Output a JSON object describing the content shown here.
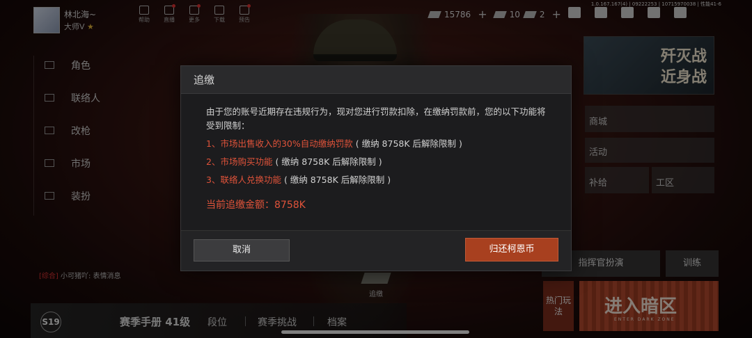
{
  "player": {
    "name": "林北海~",
    "rank": "大师V"
  },
  "top_icons": [
    {
      "label": "帮助"
    },
    {
      "label": "直播"
    },
    {
      "label": "更多"
    },
    {
      "label": "下载"
    },
    {
      "label": "预告"
    }
  ],
  "currencies": {
    "coins": "15786",
    "tickets": "10",
    "tokens": "2"
  },
  "version": "1.0.167.167(4) | 09222253 | 10715970038 | 性能41-6",
  "left_menu": [
    "角色",
    "联络人",
    "改枪",
    "市场",
    "装扮"
  ],
  "chat": {
    "channel": "[综合]",
    "text": "小可猪吖: 表情消息"
  },
  "bottom": {
    "season": "S19",
    "season_book": "赛季手册 41级",
    "tabs": [
      "段位",
      "赛季挑战",
      "档案"
    ]
  },
  "zhuijiao_label": "追缴",
  "right": {
    "banner": [
      "歼灭战",
      "近身战"
    ],
    "menu": [
      "商城",
      "活动",
      "补给",
      "工区"
    ],
    "commander": "指挥官扮演",
    "training": "训练",
    "hot": "热门玩法",
    "enter": "进入暗区",
    "enter_sub": "ENTER DARK ZONE"
  },
  "dialog": {
    "title": "追缴",
    "intro": "由于您的账号近期存在违规行为，现对您进行罚款扣除，在缴纳罚款前，您的以下功能将受到限制：",
    "items": [
      {
        "title": "1、市场出售收入的30%自动缴纳罚款",
        "note": "( 缴纳 8758K 后解除限制 )"
      },
      {
        "title": "2、市场购买功能",
        "note": "( 缴纳 8758K 后解除限制 )"
      },
      {
        "title": "3、联络人兑换功能",
        "note": "( 缴纳 8758K 后解除限制 )"
      }
    ],
    "amount": "当前追缴金额：8758K",
    "cancel": "取消",
    "confirm": "归还柯恩币"
  }
}
